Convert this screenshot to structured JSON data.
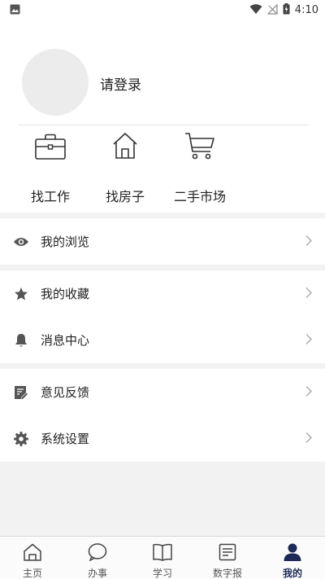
{
  "status_bar": {
    "time": "4:10",
    "icons": [
      "image-icon",
      "wifi-icon",
      "no-signal-icon",
      "battery-icon"
    ]
  },
  "profile": {
    "login_text": "请登录"
  },
  "quick_links": [
    {
      "label": "找工作",
      "icon": "briefcase-icon"
    },
    {
      "label": "找房子",
      "icon": "house-icon"
    },
    {
      "label": "二手市场",
      "icon": "cart-icon"
    }
  ],
  "menu": {
    "browse": "我的浏览",
    "favorites": "我的收藏",
    "messages": "消息中心",
    "feedback": "意见反馈",
    "settings": "系统设置"
  },
  "bottom_nav": [
    {
      "label": "主页",
      "icon": "home-icon"
    },
    {
      "label": "办事",
      "icon": "chat-icon"
    },
    {
      "label": "学习",
      "icon": "book-icon"
    },
    {
      "label": "数字报",
      "icon": "newspaper-icon"
    },
    {
      "label": "我的",
      "icon": "profile-icon",
      "active": true
    }
  ],
  "colors": {
    "accent": "#1c2a55",
    "icon_gray": "#555555",
    "background": "#f2f2f2"
  }
}
